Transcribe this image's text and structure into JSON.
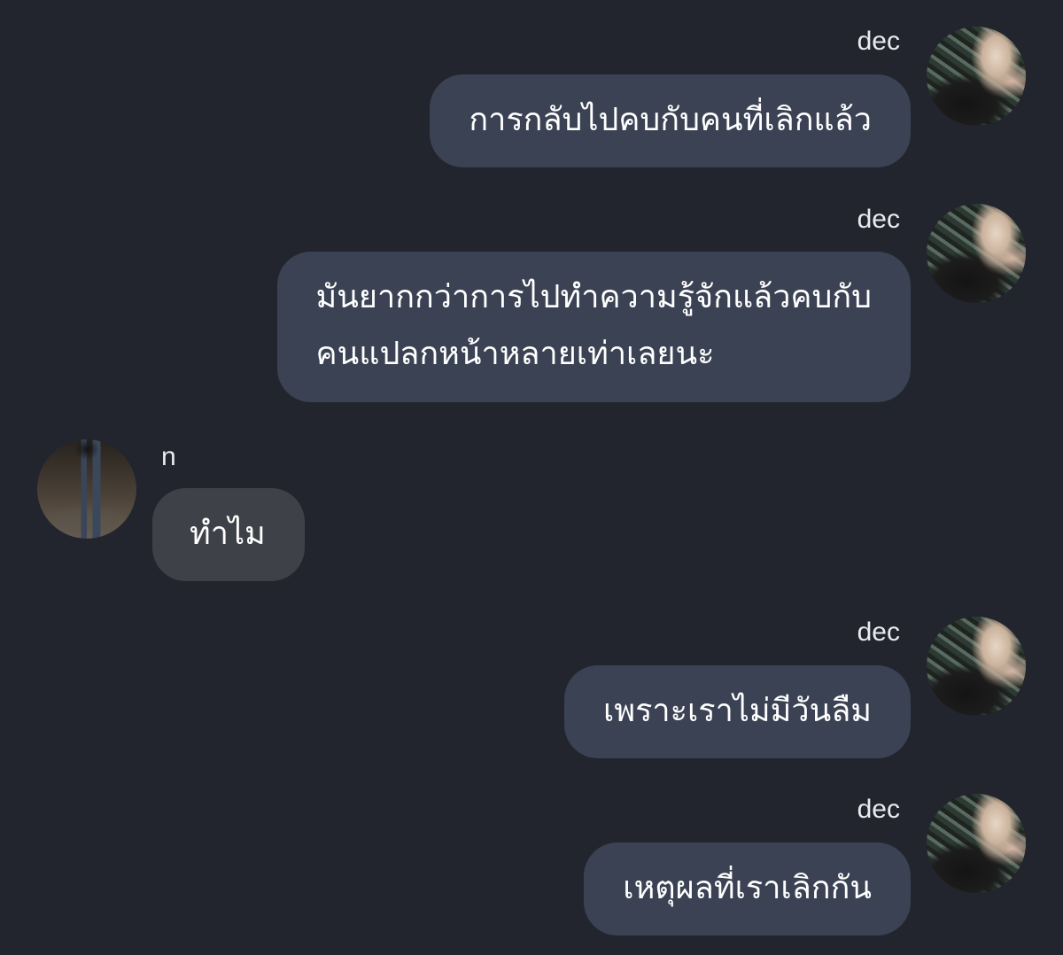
{
  "messages": [
    {
      "sender": "dec",
      "text": "การกลับไปคบกับคนที่เลิกแล้ว",
      "avatar_icon": "user-avatar-dec"
    },
    {
      "sender": "dec",
      "text": "มันยากกว่าการไปทำความรู้จักแล้วคบกับ\nคนแปลกหน้าหลายเท่าเลยนะ",
      "avatar_icon": "user-avatar-dec"
    },
    {
      "sender": "n",
      "text": "ทำไม",
      "avatar_icon": "user-avatar-n"
    },
    {
      "sender": "dec",
      "text": "เพราะเราไม่มีวันลืม",
      "avatar_icon": "user-avatar-dec"
    },
    {
      "sender": "dec",
      "text": "เหตุผลที่เราเลิกกัน",
      "avatar_icon": "user-avatar-dec"
    }
  ],
  "colors": {
    "background": "#22252d",
    "outgoing_bubble": "#3a4253",
    "incoming_bubble": "#3f4148",
    "text": "#ffffff"
  }
}
